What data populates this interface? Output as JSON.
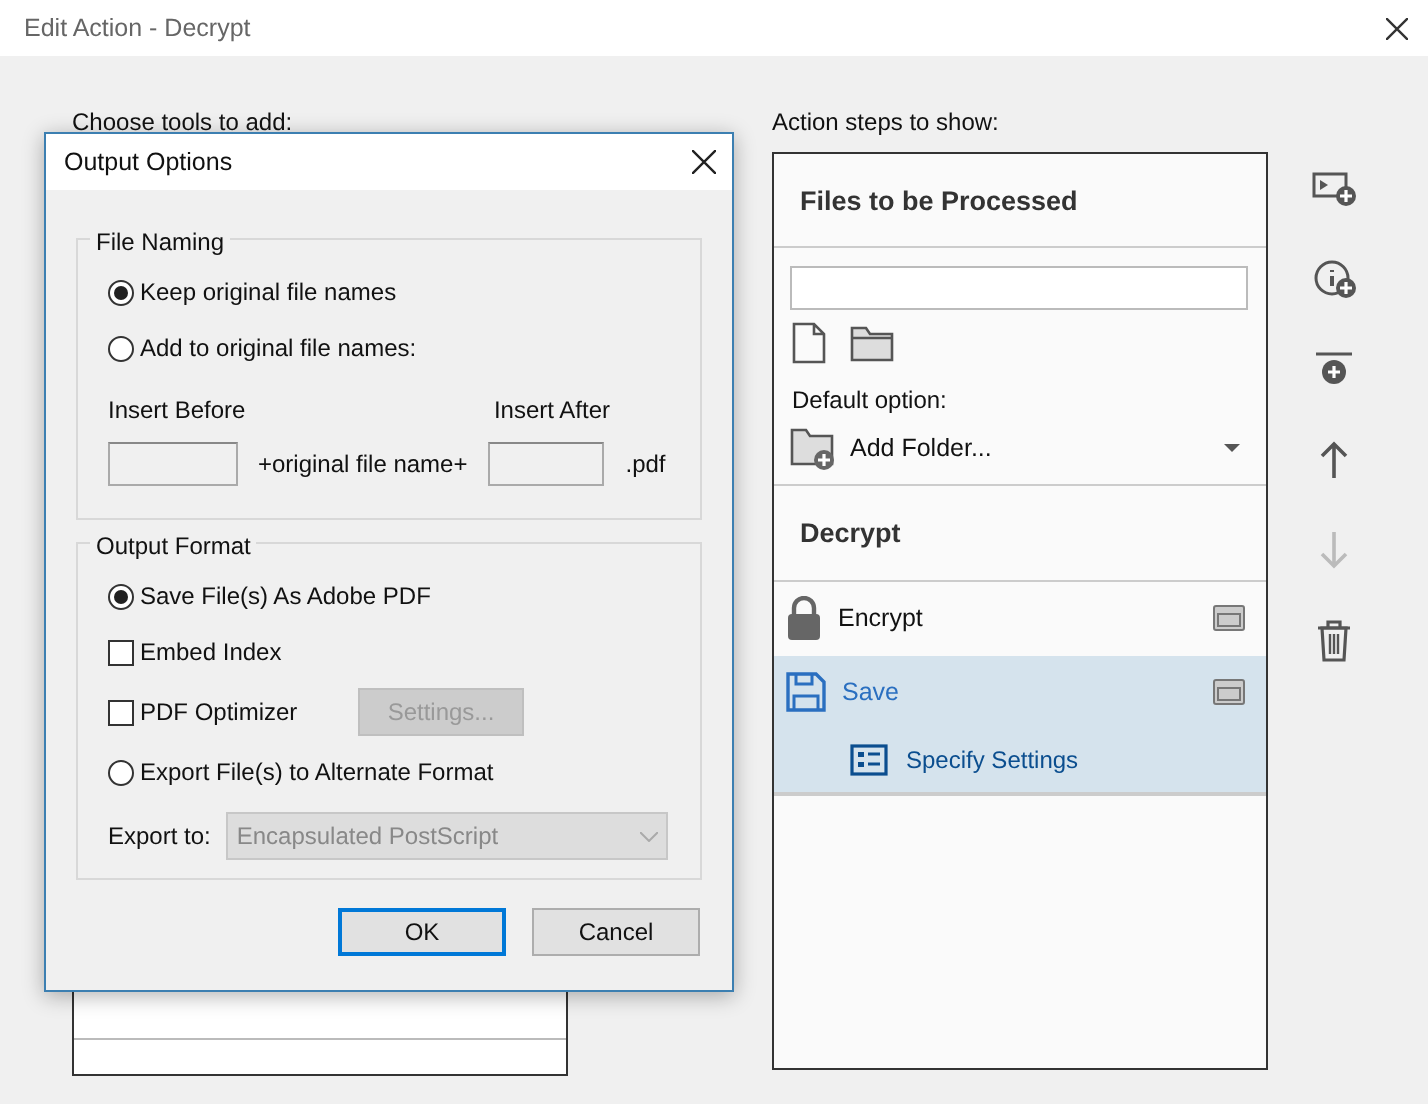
{
  "window": {
    "title": "Edit Action - Decrypt"
  },
  "tools_panel": {
    "label": "Choose tools to add:"
  },
  "steps_panel": {
    "label": "Action steps to show:",
    "files_title": "Files to be Processed",
    "default_option_label": "Default option:",
    "default_option": "Add Folder...",
    "steps": [
      {
        "kind": "heading",
        "label": "Decrypt"
      },
      {
        "kind": "step",
        "label": "Encrypt",
        "selected": false
      },
      {
        "kind": "step",
        "label": "Save",
        "selected": true
      },
      {
        "kind": "substep",
        "label": "Specify Settings",
        "selected": true
      }
    ]
  },
  "toolbar": [
    {
      "disabled": false
    },
    {
      "disabled": false
    },
    {
      "disabled": false
    },
    {
      "disabled": false
    },
    {
      "disabled": true
    },
    {
      "disabled": false
    }
  ],
  "dialog": {
    "title": "Output Options",
    "file_naming": {
      "legend": "File Naming",
      "options": [
        {
          "label": "Keep original file names",
          "selected": true
        },
        {
          "label": "Add to original file names:",
          "selected": false
        }
      ],
      "insert_before_label": "Insert Before",
      "insert_after_label": "Insert After",
      "middle_text": "+original file name+",
      "suffix": ".pdf"
    },
    "output_format": {
      "legend": "Output Format",
      "items": [
        {
          "kind": "radio",
          "label": "Save File(s) As Adobe PDF",
          "selected": true
        },
        {
          "kind": "checkbox",
          "label": "Embed Index",
          "checked": false
        },
        {
          "kind": "checkbox",
          "label": "PDF Optimizer",
          "checked": false,
          "button": {
            "label": "Settings...",
            "disabled": true
          }
        },
        {
          "kind": "radio",
          "label": "Export File(s) to Alternate Format",
          "selected": false
        }
      ],
      "export_label": "Export to:",
      "export_value": "Encapsulated PostScript",
      "export_disabled": true
    },
    "buttons": [
      {
        "label": "OK",
        "default": true
      },
      {
        "label": "Cancel",
        "default": false
      }
    ]
  }
}
